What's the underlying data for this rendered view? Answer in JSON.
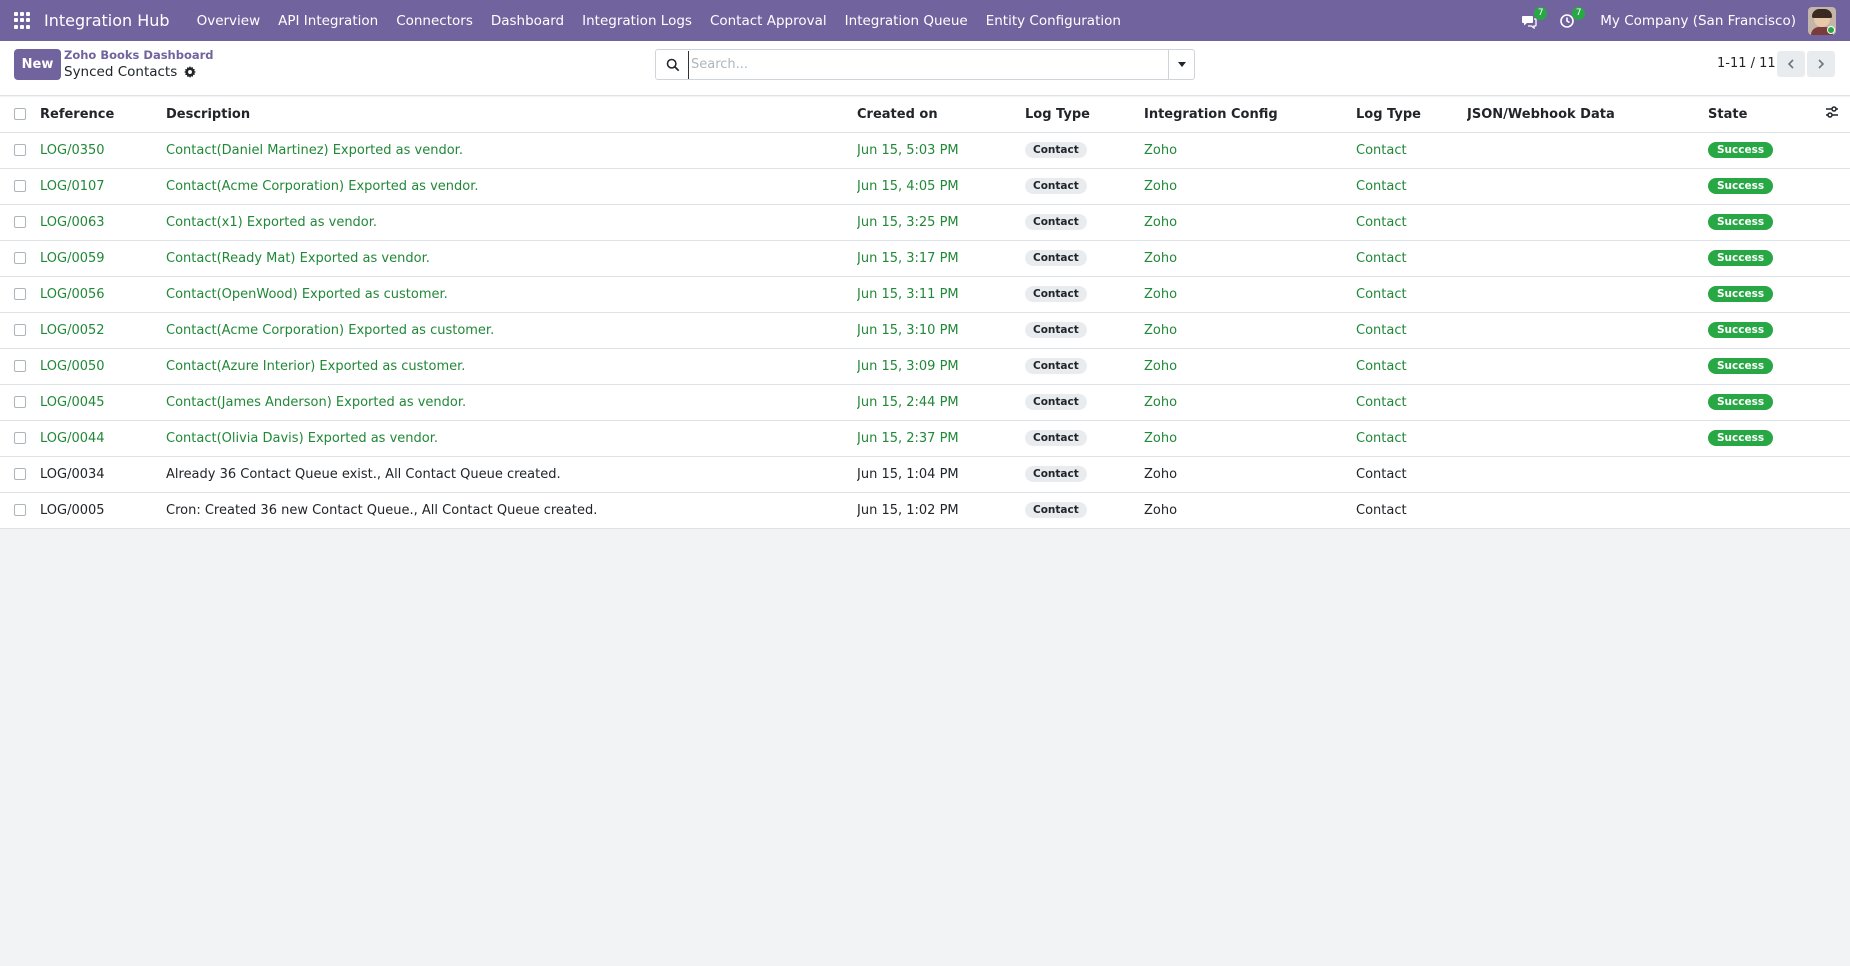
{
  "navbar": {
    "app_name": "Integration Hub",
    "menu": [
      "Overview",
      "API Integration",
      "Connectors",
      "Dashboard",
      "Integration Logs",
      "Contact Approval",
      "Integration Queue",
      "Entity Configuration"
    ],
    "messages_count": "7",
    "activities_count": "7",
    "company": "My Company (San Francisco)",
    "brand_color": "#71639e"
  },
  "control": {
    "new_label": "New",
    "breadcrumb": "Zoho Books Dashboard",
    "view_title": "Synced Contacts",
    "search_placeholder": "Search...",
    "pager": "1-11 / 11"
  },
  "table": {
    "columns": [
      "Reference",
      "Description",
      "Created on",
      "Log Type",
      "Integration Config",
      "Log Type",
      "JSON/Webhook Data",
      "State"
    ],
    "rows": [
      {
        "reference": "LOG/0350",
        "description": "Contact(Daniel Martinez) Exported as vendor.",
        "created_on": "Jun 15, 5:03 PM",
        "log_type": "Contact",
        "integration_config": "Zoho",
        "log_type2": "Contact",
        "json_data": "",
        "state": "Success"
      },
      {
        "reference": "LOG/0107",
        "description": "Contact(Acme Corporation) Exported as vendor.",
        "created_on": "Jun 15, 4:05 PM",
        "log_type": "Contact",
        "integration_config": "Zoho",
        "log_type2": "Contact",
        "json_data": "",
        "state": "Success"
      },
      {
        "reference": "LOG/0063",
        "description": "Contact(x1) Exported as vendor.",
        "created_on": "Jun 15, 3:25 PM",
        "log_type": "Contact",
        "integration_config": "Zoho",
        "log_type2": "Contact",
        "json_data": "",
        "state": "Success"
      },
      {
        "reference": "LOG/0059",
        "description": "Contact(Ready Mat) Exported as vendor.",
        "created_on": "Jun 15, 3:17 PM",
        "log_type": "Contact",
        "integration_config": "Zoho",
        "log_type2": "Contact",
        "json_data": "",
        "state": "Success"
      },
      {
        "reference": "LOG/0056",
        "description": "Contact(OpenWood) Exported as customer.",
        "created_on": "Jun 15, 3:11 PM",
        "log_type": "Contact",
        "integration_config": "Zoho",
        "log_type2": "Contact",
        "json_data": "",
        "state": "Success"
      },
      {
        "reference": "LOG/0052",
        "description": "Contact(Acme Corporation) Exported as customer.",
        "created_on": "Jun 15, 3:10 PM",
        "log_type": "Contact",
        "integration_config": "Zoho",
        "log_type2": "Contact",
        "json_data": "",
        "state": "Success"
      },
      {
        "reference": "LOG/0050",
        "description": "Contact(Azure Interior) Exported as customer.",
        "created_on": "Jun 15, 3:09 PM",
        "log_type": "Contact",
        "integration_config": "Zoho",
        "log_type2": "Contact",
        "json_data": "",
        "state": "Success"
      },
      {
        "reference": "LOG/0045",
        "description": "Contact(James Anderson) Exported as vendor.",
        "created_on": "Jun 15, 2:44 PM",
        "log_type": "Contact",
        "integration_config": "Zoho",
        "log_type2": "Contact",
        "json_data": "",
        "state": "Success"
      },
      {
        "reference": "LOG/0044",
        "description": "Contact(Olivia Davis) Exported as vendor.",
        "created_on": "Jun 15, 2:37 PM",
        "log_type": "Contact",
        "integration_config": "Zoho",
        "log_type2": "Contact",
        "json_data": "",
        "state": "Success"
      },
      {
        "reference": "LOG/0034",
        "description": "Already 36 Contact Queue exist., All Contact Queue created.",
        "created_on": "Jun 15, 1:04 PM",
        "log_type": "Contact",
        "integration_config": "Zoho",
        "log_type2": "Contact",
        "json_data": "",
        "state": ""
      },
      {
        "reference": "LOG/0005",
        "description": "Cron: Created 36 new Contact Queue., All Contact Queue created.",
        "created_on": "Jun 15, 1:02 PM",
        "log_type": "Contact",
        "integration_config": "Zoho",
        "log_type2": "Contact",
        "json_data": "",
        "state": ""
      }
    ]
  },
  "colors": {
    "success": "#28a745",
    "success_text": "#218838",
    "badge_bg": "#e9ecef",
    "page_bg": "#f1f3f5"
  }
}
